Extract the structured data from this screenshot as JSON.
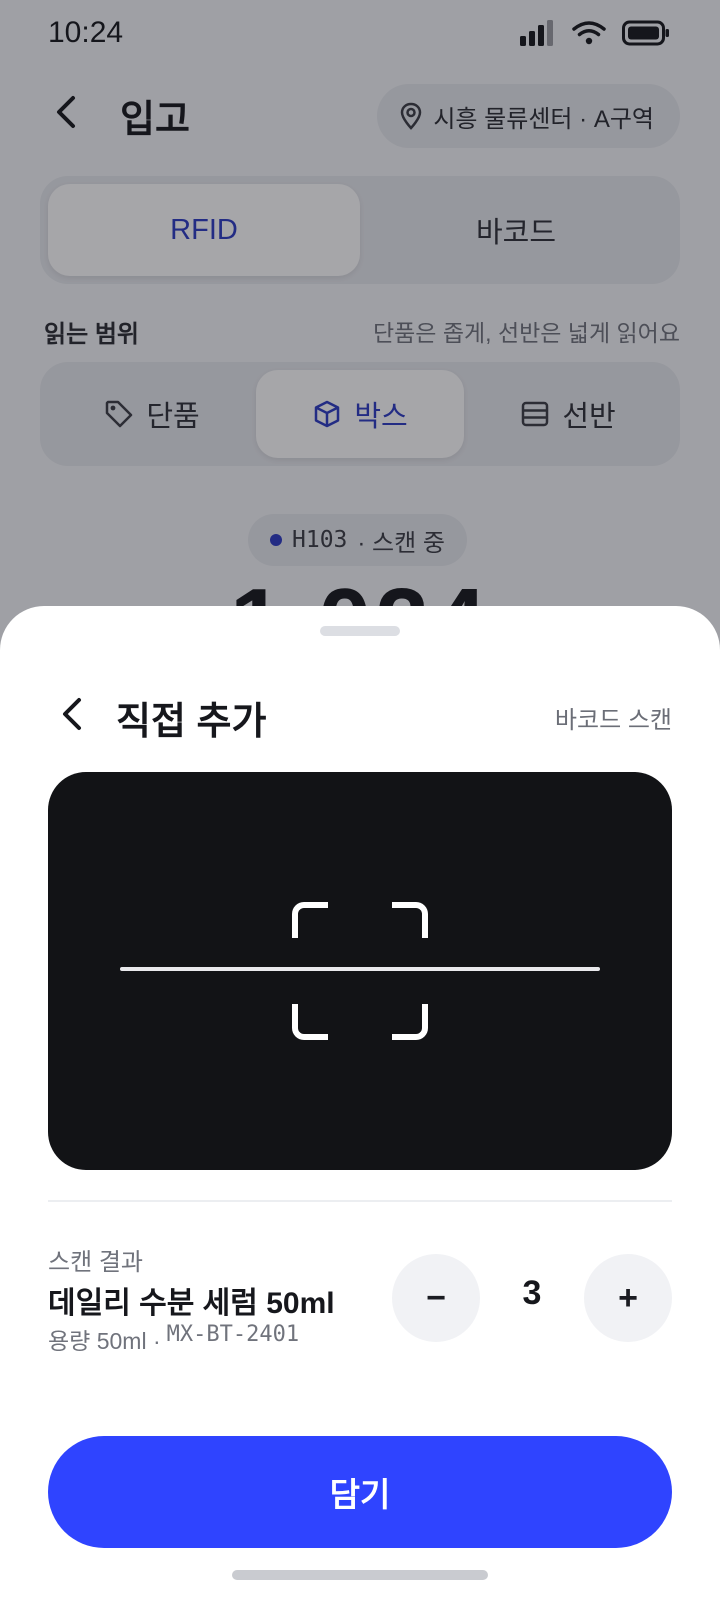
{
  "status_bar": {
    "time": "10:24",
    "icons": [
      "signal-icon",
      "wifi-icon",
      "battery-icon"
    ]
  },
  "header": {
    "title": "입고",
    "location": "시흥 물류센터 · A구역"
  },
  "mode_tabs": [
    {
      "label": "RFID",
      "active": true
    },
    {
      "label": "바코드",
      "active": false
    }
  ],
  "read_range": {
    "label": "읽는 범위",
    "hint": "단품은 좁게, 선반은 넓게 읽어요",
    "options": [
      {
        "label": "단품",
        "icon": "tag-icon",
        "active": false
      },
      {
        "label": "박스",
        "icon": "box-icon",
        "active": true
      },
      {
        "label": "선반",
        "icon": "shelf-icon",
        "active": false
      }
    ]
  },
  "scan_status": {
    "device": "H103",
    "state": "· 스캔 중"
  },
  "sheet": {
    "title": "직접 추가",
    "link": "바코드 스캔",
    "result": {
      "label": "스캔 결과",
      "name": "데일리 수분 세럼 50ml",
      "volume": "용량 50ml ·",
      "sku": "MX-BT-2401"
    },
    "stepper": {
      "minus": "−",
      "quantity": "3",
      "plus": "+"
    },
    "primary_button": "담기"
  },
  "colors": {
    "accent": "#2f44ff",
    "selected_text": "#2c3bc4",
    "camera_bg": "#121316"
  }
}
